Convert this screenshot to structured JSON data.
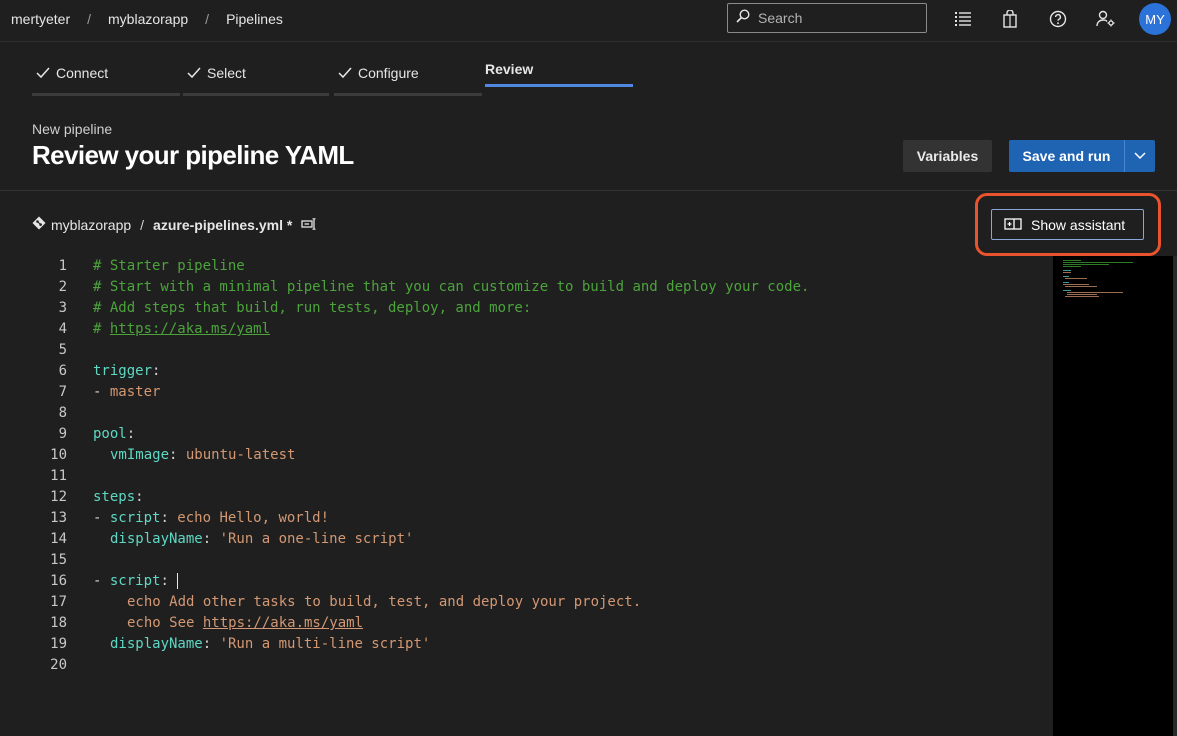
{
  "breadcrumb": {
    "org": "mertyeter",
    "project": "myblazorapp",
    "section": "Pipelines",
    "separator": "/"
  },
  "search": {
    "placeholder": "Search"
  },
  "user": {
    "initials": "MY"
  },
  "wizard": {
    "steps": [
      {
        "label": "Connect",
        "done": true
      },
      {
        "label": "Select",
        "done": true
      },
      {
        "label": "Configure",
        "done": true
      },
      {
        "label": "Review",
        "done": false
      }
    ]
  },
  "header": {
    "subtitle": "New pipeline",
    "title": "Review your pipeline YAML"
  },
  "actions": {
    "variables_label": "Variables",
    "save_run_label": "Save and run"
  },
  "file": {
    "repo": "myblazorapp",
    "separator": "/",
    "name": "azure-pipelines.yml *"
  },
  "assistant": {
    "label": "Show assistant"
  },
  "editor": {
    "line_numbers": [
      "1",
      "2",
      "3",
      "4",
      "5",
      "6",
      "7",
      "8",
      "9",
      "10",
      "11",
      "12",
      "13",
      "14",
      "15",
      "16",
      "17",
      "18",
      "19",
      "20"
    ],
    "lines": {
      "l1": "# Starter pipeline",
      "l2": "# Start with a minimal pipeline that you can customize to build and deploy your code.",
      "l3": "# Add steps that build, run tests, deploy, and more:",
      "l4_hash": "# ",
      "l4_url": "https://aka.ms/yaml",
      "l6_key": "trigger",
      "l7_dash": "- ",
      "l7_val": "master",
      "l9_key": "pool",
      "l10_key": "vmImage",
      "l10_val": "ubuntu-latest",
      "l12_key": "steps",
      "l13_dash": "- ",
      "l13_key": "script",
      "l13_val": "echo Hello, world!",
      "l14_key": "displayName",
      "l14_val": "'Run a one-line script'",
      "l16_dash": "- ",
      "l16_key": "script",
      "l17_val": "echo Add other tasks to build, test, and deploy your project.",
      "l18_pre": "echo See ",
      "l18_url": "https://aka.ms/yaml",
      "l19_key": "displayName",
      "l19_val": "'Run a multi-line script'"
    }
  },
  "colors": {
    "accent": "#1f63b3",
    "active_step": "#4f89e0",
    "highlight": "#e9542e",
    "yaml_key": "#5ed8c4",
    "yaml_value": "#d39873",
    "yaml_comment": "#4ca33c"
  }
}
